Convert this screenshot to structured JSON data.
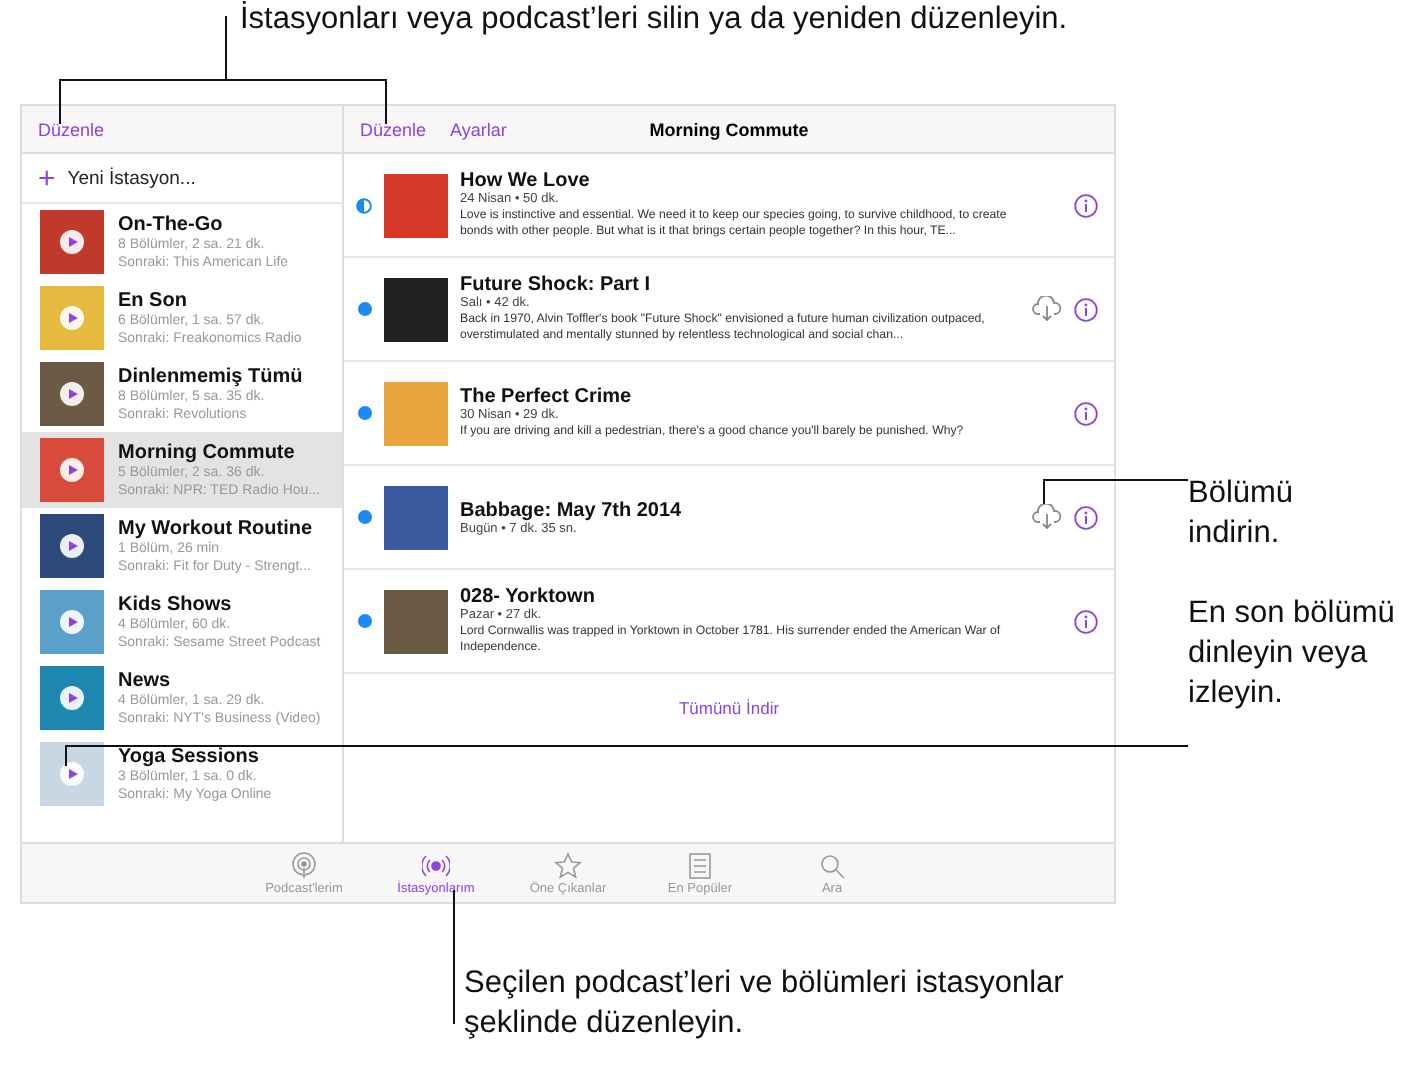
{
  "callouts": {
    "top": "İstasyonları veya podcast’leri silin ya da yeniden düzenleyin.",
    "download": "Bölümü indirin.",
    "play": "En son bölümü dinleyin veya izleyin.",
    "bottom": "Seçilen podcast’leri ve bölümleri istasyonlar şeklinde düzenleyin."
  },
  "sidebar": {
    "edit": "Düzenle",
    "new_station": {
      "icon": "+",
      "label": "Yeni İstasyon..."
    },
    "stations": [
      {
        "name": "On-The-Go",
        "info": "8 Bölümler, 2 sa. 21 dk.",
        "next": "Sonraki: This American Life",
        "selected": false
      },
      {
        "name": "En Son",
        "info": "6 Bölümler, 1 sa. 57 dk.",
        "next": "Sonraki: Freakonomics Radio",
        "selected": false
      },
      {
        "name": "Dinlenmemiş Tümü",
        "info": "8 Bölümler, 5 sa. 35 dk.",
        "next": "Sonraki: Revolutions",
        "selected": false
      },
      {
        "name": "Morning Commute",
        "info": "5 Bölümler, 2 sa. 36 dk.",
        "next": "Sonraki: NPR: TED Radio Hou...",
        "selected": true
      },
      {
        "name": "My Workout Routine",
        "info": "1 Bölüm, 26 min",
        "next": "Sonraki: Fit for Duty - Strengt...",
        "selected": false
      },
      {
        "name": "Kids Shows",
        "info": "4 Bölümler, 60 dk.",
        "next": "Sonraki: Sesame Street Podcast",
        "selected": false
      },
      {
        "name": "News",
        "info": "4 Bölümler, 1 sa. 29 dk.",
        "next": "Sonraki: NYT's Business (Video)",
        "selected": false
      },
      {
        "name": "Yoga Sessions",
        "info": "3 Bölümler, 1 sa. 0 dk.",
        "next": "Sonraki: My Yoga Online",
        "selected": false
      }
    ]
  },
  "header": {
    "edit": "Düzenle",
    "settings": "Ayarlar",
    "title": "Morning Commute"
  },
  "episodes": [
    {
      "title": "How We Love",
      "meta": "24 Nisan • 50 dk.",
      "description": "Love is instinctive and essential. We need it to keep our species going, to survive childhood, to create bonds with other people. But what is it that brings certain people together?  In this hour, TE...",
      "kind": "partial",
      "downloadable": false
    },
    {
      "title": "Future Shock: Part I",
      "meta": "Salı • 42 dk.",
      "description": "Back in 1970, Alvin Toffler's book \"Future Shock\" envisioned a future human civilization outpaced, overstimulated and mentally stunned by relentless technological and social chan...",
      "kind": "new",
      "downloadable": true
    },
    {
      "title": "The Perfect Crime",
      "meta": "30 Nisan • 29 dk.",
      "description": "If you are driving and kill a pedestrian, there's a good chance you'll barely be punished. Why?",
      "kind": "new",
      "downloadable": false
    },
    {
      "title": "Babbage: May 7th 2014",
      "meta": "Bugün • 7 dk. 35 sn.",
      "kind": "new",
      "downloadable": true
    },
    {
      "title": "028- Yorktown",
      "meta": "Pazar • 27 dk.",
      "description": "Lord Cornwallis was trapped in Yorktown in October 1781. His surrender ended the American War of Independence.",
      "kind": "new",
      "downloadable": false
    }
  ],
  "download_all": "Tümünü İndir",
  "tabs": [
    {
      "label": "Podcast'lerim",
      "selected": false
    },
    {
      "label": "İstasyonlarım",
      "selected": true
    },
    {
      "label": "Öne Çıkanlar",
      "selected": false
    },
    {
      "label": "En Popüler",
      "selected": false
    },
    {
      "label": "Ara",
      "selected": false
    }
  ]
}
